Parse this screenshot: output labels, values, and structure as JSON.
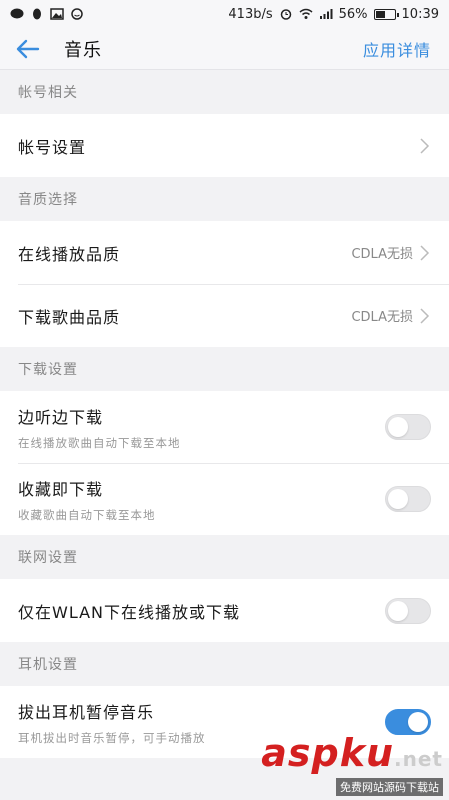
{
  "status_bar": {
    "speed": "413b/s",
    "battery": "56%",
    "battery_level": 0.56,
    "time": "10:39"
  },
  "header": {
    "title": "音乐",
    "app_detail": "应用详情"
  },
  "sections": {
    "account": {
      "header": "帐号相关",
      "account_settings": "帐号设置"
    },
    "quality": {
      "header": "音质选择",
      "online_quality": {
        "label": "在线播放品质",
        "value": "CDLA无损"
      },
      "download_quality": {
        "label": "下载歌曲品质",
        "value": "CDLA无损"
      }
    },
    "download": {
      "header": "下载设置",
      "listen_download": {
        "label": "边听边下载",
        "sub": "在线播放歌曲自动下载至本地",
        "on": false
      },
      "fav_download": {
        "label": "收藏即下载",
        "sub": "收藏歌曲自动下载至本地",
        "on": false
      }
    },
    "network": {
      "header": "联网设置",
      "wlan_only": {
        "label": "仅在WLAN下在线播放或下载",
        "on": false
      }
    },
    "headset": {
      "header": "耳机设置",
      "pause_on_unplug": {
        "label": "拔出耳机暂停音乐",
        "sub": "耳机拔出时音乐暂停，可手动播放",
        "on": true
      }
    }
  },
  "watermark": {
    "logo": "aspku",
    "logo_suffix": ".net",
    "text": "免费网站源码下载站"
  },
  "colors": {
    "accent": "#3a8dde",
    "background": "#f2f2f4"
  }
}
